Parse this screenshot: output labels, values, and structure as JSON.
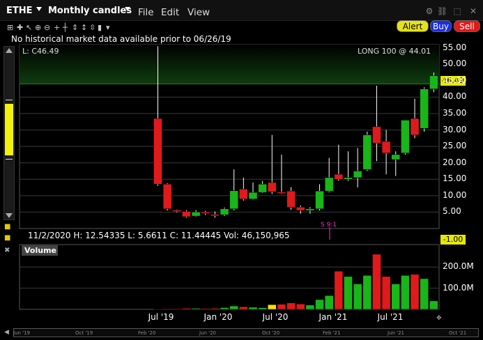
{
  "window": {
    "symbol": "ETHE",
    "period": "Monthly candles",
    "menu": [
      "File",
      "Edit",
      "View"
    ]
  },
  "toolbar": {
    "alert_label": "Alert",
    "buy_label": "Buy",
    "sell_label": "Sell"
  },
  "notice": "No historical market data available prior to 06/26/19",
  "overlay": {
    "last": "L: C46.49",
    "position": "LONG 100 @ 44.01",
    "ohlc": "11/2/2020  H: 12.54335  L: 5.6611  C: 11.44445  Vol: 46,150,965",
    "split": "S 9:1",
    "volume_title": "Volume",
    "price_tag": "46.49",
    "zero_tag": "-1.00"
  },
  "colors": {
    "up": "#19b519",
    "down": "#e01a1a",
    "neutral": "#ffe000",
    "highlight_band": "#0f3d0f"
  },
  "chart_data": {
    "type": "candlestick",
    "price_axis": {
      "ticks": [
        "55.00",
        "50.00",
        "45.00",
        "40.00",
        "35.00",
        "30.00",
        "25.00",
        "20.00",
        "15.00",
        "10.00",
        "5.00"
      ],
      "ylim": [
        0,
        56
      ]
    },
    "volume_axis": {
      "ticks": [
        "200.0M",
        "100.0M"
      ],
      "ylim": [
        0,
        250
      ]
    },
    "x_labels": [
      "Jul '19",
      "Jan '20",
      "Jul '20",
      "Jan '21",
      "Jul '21"
    ],
    "nav_labels": [
      "Jun '19",
      "Oct '19",
      "Feb '20",
      "Jun '20",
      "Oct '20",
      "Feb '21",
      "Jun '21",
      "Oct '21"
    ],
    "candles": [
      {
        "o": 33.5,
        "h": 55.5,
        "l": 13.0,
        "c": 13.5,
        "v": 2
      },
      {
        "o": 13.5,
        "h": 13.8,
        "l": 5.5,
        "c": 6.0,
        "v": 3
      },
      {
        "o": 5.6,
        "h": 5.8,
        "l": 4.9,
        "c": 5.2,
        "v": 3
      },
      {
        "o": 5.2,
        "h": 5.6,
        "l": 3.3,
        "c": 3.6,
        "v": 5
      },
      {
        "o": 3.8,
        "h": 5.6,
        "l": 3.6,
        "c": 5.0,
        "v": 5
      },
      {
        "o": 5.0,
        "h": 5.4,
        "l": 4.1,
        "c": 4.6,
        "v": 4
      },
      {
        "o": 4.3,
        "h": 5.2,
        "l": 3.3,
        "c": 3.9,
        "v": 5
      },
      {
        "o": 4.2,
        "h": 6.4,
        "l": 3.8,
        "c": 6.0,
        "v": 8
      },
      {
        "o": 6.0,
        "h": 18.0,
        "l": 5.5,
        "c": 11.5,
        "v": 16
      },
      {
        "o": 12.0,
        "h": 15.5,
        "l": 8.5,
        "c": 9.0,
        "v": 12
      },
      {
        "o": 9.0,
        "h": 14.0,
        "l": 8.8,
        "c": 11.0,
        "v": 10
      },
      {
        "o": 11.0,
        "h": 14.5,
        "l": 10.8,
        "c": 13.5,
        "v": 8
      },
      {
        "o": 14.0,
        "h": 28.5,
        "l": 10.5,
        "c": 11.2,
        "v": 22
      },
      {
        "o": 11.1,
        "h": 22.5,
        "l": 10.5,
        "c": 11.0,
        "v": 24
      },
      {
        "o": 11.4,
        "h": 12.6,
        "l": 5.7,
        "c": 6.5,
        "v": 30
      },
      {
        "o": 6.5,
        "h": 7.0,
        "l": 4.5,
        "c": 5.5,
        "v": 25
      },
      {
        "o": 5.5,
        "h": 6.5,
        "l": 4.5,
        "c": 6.0,
        "v": 20
      },
      {
        "o": 6.0,
        "h": 13.5,
        "l": 5.5,
        "c": 11.4,
        "v": 46
      },
      {
        "o": 11.4,
        "h": 21.5,
        "l": 11.0,
        "c": 15.5,
        "v": 65
      },
      {
        "o": 16.5,
        "h": 25.5,
        "l": 14.5,
        "c": 15.0,
        "v": 180
      },
      {
        "o": 15.0,
        "h": 23.5,
        "l": 14.5,
        "c": 15.5,
        "v": 155
      },
      {
        "o": 15.5,
        "h": 24.5,
        "l": 12.5,
        "c": 17.5,
        "v": 120
      },
      {
        "o": 18.0,
        "h": 29.5,
        "l": 17.5,
        "c": 28.5,
        "v": 160
      },
      {
        "o": 31.0,
        "h": 43.5,
        "l": 20.5,
        "c": 26.0,
        "v": 260
      },
      {
        "o": 26.5,
        "h": 30.0,
        "l": 16.5,
        "c": 23.0,
        "v": 155
      },
      {
        "o": 21.0,
        "h": 23.5,
        "l": 16.0,
        "c": 22.5,
        "v": 120
      },
      {
        "o": 23.0,
        "h": 32.5,
        "l": 22.5,
        "c": 33.0,
        "v": 160
      },
      {
        "o": 33.5,
        "h": 39.5,
        "l": 27.5,
        "c": 28.5,
        "v": 165
      },
      {
        "o": 30.5,
        "h": 43.0,
        "l": 29.5,
        "c": 42.5,
        "v": 145
      },
      {
        "o": 42.5,
        "h": 47.5,
        "l": 41.5,
        "c": 46.5,
        "v": 40
      }
    ]
  }
}
